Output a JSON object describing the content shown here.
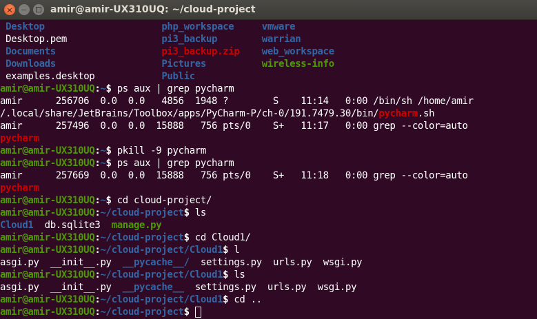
{
  "window": {
    "title": "amir@amir-UX310UQ: ~/cloud-project",
    "close_glyph": "×",
    "minimize_glyph": "−"
  },
  "colors": {
    "background": "#300a24",
    "prompt_user": "#4e9a06",
    "path_and_dirs": "#3465a4",
    "grep_match_and_archives": "#cc0000",
    "executables": "#4e9a06",
    "text": "#ffffff"
  },
  "terminal": {
    "listing": [
      [
        "Desktop",
        "php_workspace",
        "vmware"
      ],
      [
        "Desktop.pem",
        "pi3_backup",
        "warrian"
      ],
      [
        "Documents",
        "pi3_backup.zip",
        "web_workspace"
      ],
      [
        "Downloads",
        "Pictures",
        "wireless-info"
      ],
      [
        "examples.desktop",
        "Public"
      ]
    ],
    "prompt_user": "amir@amir-UX310UQ",
    "prompt_colon": ":",
    "prompt_dollar": "$ ",
    "prompt_tilde": "~",
    "path_cloud": "~/cloud-project",
    "path_cloud1": "~/cloud-project/Cloud1",
    "cmd_ps": "ps aux | grep pycharm",
    "ps1_line1": "amir      256706  0.0  0.0   4856  1948 ?        S    11:14   0:00 /bin/sh /home/amir",
    "ps1_line2_pre": "/.local/share/JetBrains/Toolbox/apps/PyCharm-P/ch-0/191.7479.30/bin/",
    "ps1_line2_post": ".sh",
    "ps1_line3": "amir      257496  0.0  0.0  15888   756 pts/0    S+   11:17   0:00 grep --color=auto",
    "match_word": "pycharm",
    "cmd_pkill": "pkill -9 pycharm",
    "ps2_line1": "amir      257669  0.0  0.0  15888   756 pts/0    S+   11:18   0:00 grep --color=auto",
    "cmd_cd_cloud": "cd cloud-project/",
    "cmd_ls": "ls",
    "ls1_cloud1": "Cloud1",
    "ls1_db": "db.sqlite3",
    "ls1_manage": "manage.py",
    "cmd_cd_cloud1": "cd Cloud1/",
    "cmd_l": "l",
    "l_asgi": "asgi.py",
    "l_init": "__init__.py",
    "l_pycache": "__pycache__/",
    "l_settings": "settings.py",
    "l_urls": "urls.py",
    "l_wsgi": "wsgi.py",
    "ls2_pycache": "__pycache__",
    "cmd_cd_up": "cd .."
  }
}
